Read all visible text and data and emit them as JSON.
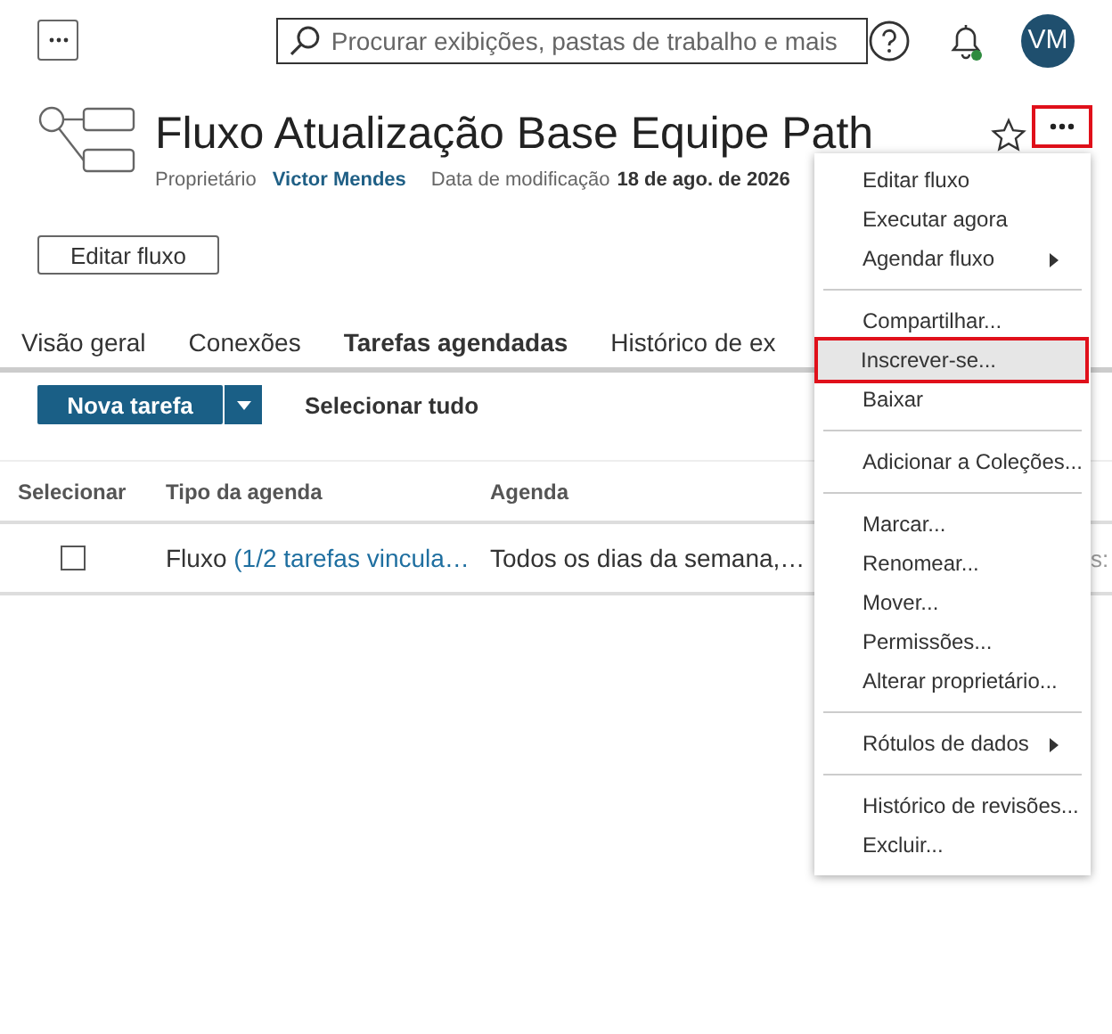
{
  "header": {
    "search": {
      "placeholder": "Procurar exibições, pastas de trabalho e mais"
    },
    "avatar": "VM",
    "notification_dot": true
  },
  "flow": {
    "title": "Fluxo Atualização Base Equipe Path",
    "favorite": false,
    "more_highlighted": true,
    "owner_label": "Proprietário",
    "owner": "Victor Mendes",
    "modified_label": "Data de modificação",
    "modified": "18 de ago. de 2026",
    "edit_button": "Editar fluxo"
  },
  "tabs": [
    {
      "label": "Visão geral",
      "selected": false
    },
    {
      "label": "Conexões",
      "selected": false
    },
    {
      "label": "Tarefas agendadas",
      "selected": true
    },
    {
      "label": "Histórico de ex",
      "selected": false
    }
  ],
  "toolbar": {
    "new_task": "Nova tarefa",
    "select_all": "Selecionar tudo"
  },
  "table": {
    "columns": [
      "Selecionar",
      "Tipo da agenda",
      "Agenda"
    ],
    "rows": [
      {
        "checked": false,
        "type": "Fluxo",
        "type_link": "(1/2 tarefas vincula…",
        "schedule": "Todos os dias da semana,…",
        "column_4": "s:"
      }
    ]
  },
  "menu": {
    "groups": [
      {
        "items": [
          {
            "label": "Editar fluxo",
            "submenu": false,
            "highlighted": false
          },
          {
            "label": "Executar agora",
            "submenu": false,
            "highlighted": false
          },
          {
            "label": "Agendar fluxo",
            "submenu": true,
            "highlighted": false
          }
        ]
      },
      {
        "items": [
          {
            "label": "Compartilhar...",
            "submenu": false,
            "highlighted": false
          },
          {
            "label": "Inscrever-se...",
            "submenu": false,
            "highlighted": true
          },
          {
            "label": "Baixar",
            "submenu": false,
            "highlighted": false
          }
        ]
      },
      {
        "items": [
          {
            "label": "Adicionar a Coleções...",
            "submenu": false,
            "highlighted": false
          }
        ]
      },
      {
        "items": [
          {
            "label": "Marcar...",
            "submenu": false,
            "highlighted": false
          },
          {
            "label": "Renomear...",
            "submenu": false,
            "highlighted": false
          },
          {
            "label": "Mover...",
            "submenu": false,
            "highlighted": false
          },
          {
            "label": "Permissões...",
            "submenu": false,
            "highlighted": false
          },
          {
            "label": "Alterar proprietário...",
            "submenu": false,
            "highlighted": false
          }
        ]
      },
      {
        "items": [
          {
            "label": "Rótulos de dados",
            "submenu": true,
            "highlighted": false
          }
        ]
      },
      {
        "items": [
          {
            "label": "Histórico de revisões...",
            "submenu": false,
            "highlighted": false
          },
          {
            "label": "Excluir...",
            "submenu": false,
            "highlighted": false
          }
        ]
      }
    ]
  }
}
